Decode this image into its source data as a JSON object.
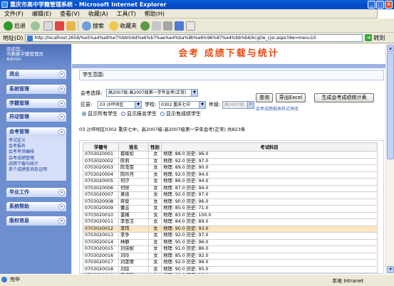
{
  "window": {
    "title": "重庆市高中学籍管理系统 - Microsoft Internet Explorer"
  },
  "menu": [
    "文件(F)",
    "编辑(E)",
    "查看(V)",
    "收藏(A)",
    "工具(T)",
    "帮助(H)"
  ],
  "toolbar": {
    "back": "后退",
    "search": "搜索",
    "favorites": "收藏夹"
  },
  "address": {
    "label": "地址(D)",
    "url": "http://localhost:2659/%e5%a4%a9%e7%bb%9d%e6%b7%ae%e4%ba%9b%e6%96%87%e4%bb%b6/kcgl/w_cjsr.aspx?dw=menu10",
    "go": "转到"
  },
  "sidebar": {
    "welcome": [
      "欢迎您，",
      "市教委学籍管理员",
      "Admin"
    ],
    "sections": [
      "退出",
      "系统管理",
      "学籍管理",
      "异动管理",
      "会考管理",
      "毕业工作",
      "系统帮助",
      "版权信息"
    ],
    "sub_items": [
      "考试定义",
      "会考报名",
      "会考考场编排",
      "会考成绩管理",
      "成绩下载与统计",
      "单个成绩查询及证明"
    ]
  },
  "banner": "会考 成绩下载与统计",
  "scope_label": "学生范围:",
  "filters": {
    "exam_label": "会考选择:",
    "exam_value": "高2007级-高2007级第一学年会考(正常)",
    "district_label": "区县:",
    "district_value": "03 沙坪坝区",
    "school_label": "学校:",
    "school_value": "0302 重庆七中",
    "grade_label": "年级:",
    "grade_value": "高2007级",
    "btn_query": "查询",
    "btn_excel": "导出Excel",
    "btn_stats": "生成会考成绩统计表",
    "stats_link": "会考成绩报表样式预览",
    "radios": [
      "显示所有学生",
      "显示报名学生",
      "显示有成绩学生"
    ]
  },
  "summary": "03 沙坪坝区0302 重庆七中，高2007级-高2007级第一学年会考(正常) 共823条",
  "table": {
    "headers": [
      "学籍号",
      "姓名",
      "性别",
      "考试科目"
    ],
    "rows": [
      [
        "0703020001",
        "蔡辉松",
        "女",
        "地理: 88.0  历史: 96.0"
      ],
      [
        "0703020002",
        "陈莉",
        "女",
        "地理: 92.0  历史: 97.0"
      ],
      [
        "0703020003",
        "陈雪雯",
        "女",
        "地理: 89.0  历史: 90.0"
      ],
      [
        "0703020004",
        "陈吟月",
        "女",
        "地理: 92.0  历史: 94.0"
      ],
      [
        "0703020005",
        "何汐",
        "女",
        "地理: 86.0  历史: 94.0"
      ],
      [
        "0703020006",
        "何悦",
        "女",
        "地理: 87.0  历史: 94.0"
      ],
      [
        "0703020007",
        "黄佳",
        "女",
        "地理: 92.0  历史: 97.0"
      ],
      [
        "0703020008",
        "蒋俊",
        "女",
        "地理: 90.0  历史: 96.0"
      ],
      [
        "0703020009",
        "蕾芸",
        "女",
        "地理: 85.0  历史: 71.0"
      ],
      [
        "0703020010",
        "雷婿",
        "女",
        "地理: 83.0  历史: 100.0"
      ],
      [
        "0703020011",
        "李思洁",
        "女",
        "地理: 84.0  历史: 89.0"
      ],
      [
        "0703020012",
        "李玮",
        "女",
        "地理: 90.0  历史: 93.0"
      ],
      [
        "0703020013",
        "李争",
        "女",
        "地理: 92.0  历史: 97.0"
      ],
      [
        "0703020014",
        "林静",
        "女",
        "地理: 95.0  历史: 96.0"
      ],
      [
        "0703020015",
        "刘佳妮",
        "女",
        "地理: 91.0  历史: 86.0"
      ],
      [
        "0703020016",
        "刘玲",
        "女",
        "地理: 85.0  历史: 92.0"
      ],
      [
        "0703020017",
        "刘雯倩",
        "女",
        "地理: 92.0  历史: 96.0"
      ],
      [
        "0703020018",
        "刘琼",
        "女",
        "地理: 90.0  历史: 95.0"
      ],
      [
        "0703020019",
        "蒋坤钦",
        "女",
        "地理: 92.0  历史: 96.0"
      ],
      [
        "0703020020",
        "罗好",
        "女",
        "地理: 93.0  历史: 92.0"
      ]
    ]
  },
  "status": {
    "left": "完毕",
    "zone": "本地 Intranet"
  }
}
